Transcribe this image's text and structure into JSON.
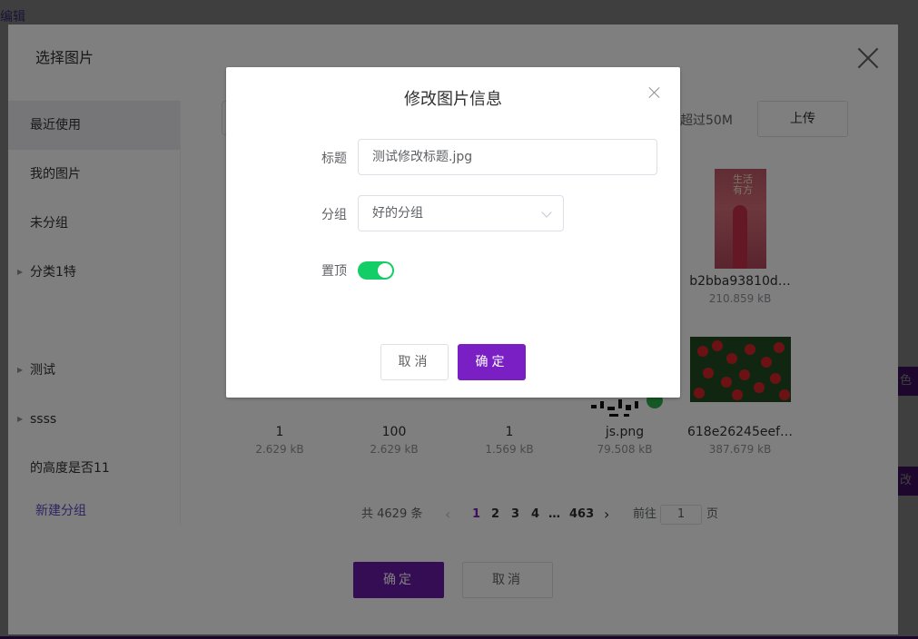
{
  "base": {
    "edit_link": "编辑",
    "right_btn_1": "色",
    "right_btn_2": "改"
  },
  "select_dialog": {
    "title": "选择图片",
    "sidebar": {
      "categories": [
        {
          "label": "最近使用",
          "active": true
        },
        {
          "label": "我的图片"
        },
        {
          "label": "未分组"
        },
        {
          "label": "分类1特",
          "expandable": true
        },
        {
          "label": "测试",
          "expandable": true
        },
        {
          "label": "ssss",
          "expandable": true
        },
        {
          "label": "的高度是否11"
        }
      ],
      "new_group": "新建分组"
    },
    "upload_tip": "超过50M",
    "upload_button": "上传",
    "images": [
      {
        "name": "b2bba93810d…",
        "size": "210.859 kB"
      },
      {
        "name": "1",
        "size": "2.629 kB"
      },
      {
        "name": "100",
        "size": "2.629 kB"
      },
      {
        "name": "1",
        "size": "1.569 kB"
      },
      {
        "name": "js.png",
        "size": "79.508 kB"
      },
      {
        "name": "618e26245eef…",
        "size": "387.679 kB"
      }
    ],
    "pink_image_text": "生活有方",
    "pagination": {
      "total": "共 4629 条",
      "prev": "‹",
      "pages": [
        "1",
        "2",
        "3",
        "4"
      ],
      "ellipsis": "…",
      "last": "463",
      "next": "›",
      "goto_label": "前往",
      "goto_value": "1",
      "goto_suffix": "页"
    },
    "confirm": "确定",
    "cancel": "取消"
  },
  "edit_dialog": {
    "title": "修改图片信息",
    "title_label": "标题",
    "title_value": "测试修改标题.jpg",
    "group_label": "分组",
    "group_value": "好的分组",
    "pin_label": "置顶",
    "pin_on": true,
    "cancel": "取消",
    "confirm": "确定"
  },
  "colors": {
    "primary": "#7a1fc4",
    "switch_on": "#13ce66",
    "link": "#5b4dc2"
  }
}
